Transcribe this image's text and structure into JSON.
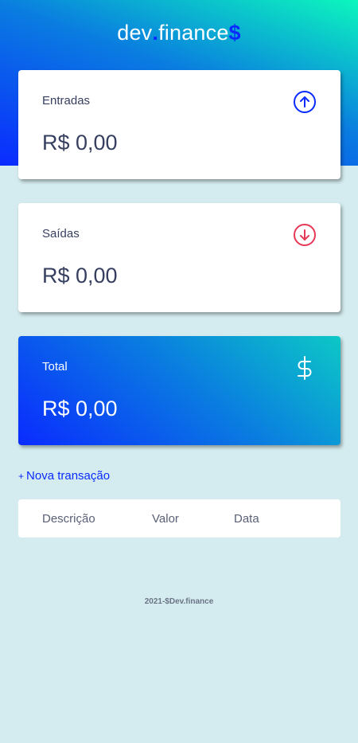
{
  "header": {
    "logo_dev": "dev",
    "logo_dot": ".",
    "logo_finance": "finance",
    "logo_sign": "$"
  },
  "cards": {
    "income": {
      "label": "Entradas",
      "value": "R$ 0,00",
      "icon": "arrow-up-circle-icon",
      "color": "#0a2bff"
    },
    "expense": {
      "label": "Saídas",
      "value": "R$ 0,00",
      "icon": "arrow-down-circle-icon",
      "color": "#e63957"
    },
    "total": {
      "label": "Total",
      "value": "R$ 0,00",
      "icon": "dollar-sign-icon",
      "color": "#ffffff"
    }
  },
  "actions": {
    "new_transaction_plus": "+",
    "new_transaction_label": "Nova transação"
  },
  "table": {
    "headers": [
      "Descrição",
      "Valor",
      "Data"
    ]
  },
  "footer": {
    "text": "2021-$Dev.finance"
  }
}
